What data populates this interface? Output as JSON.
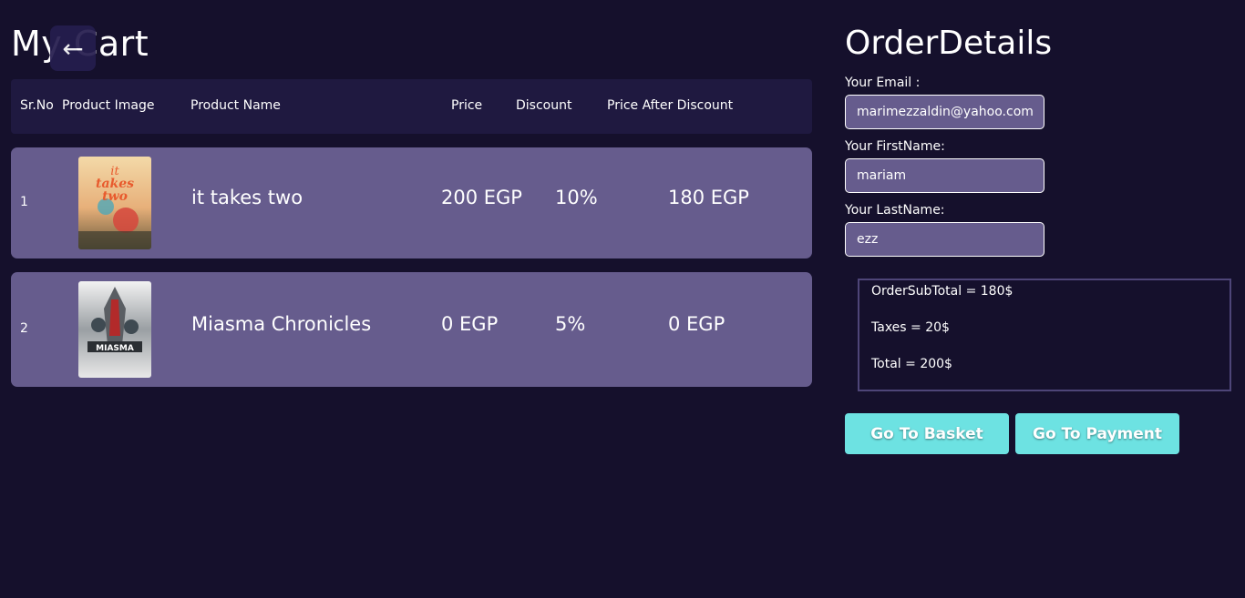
{
  "cart": {
    "title": "My Cart",
    "back_icon": "←",
    "headers": {
      "srno": "Sr.No",
      "image": "Product Image",
      "name": "Product Name",
      "price": "Price",
      "discount": "Discount",
      "after": "Price After Discount"
    },
    "rows": [
      {
        "srno": "1",
        "name": "it takes two",
        "price": "200 EGP",
        "discount": "10%",
        "after": "180 EGP",
        "image_icon": "it-takes-two-cover"
      },
      {
        "srno": "2",
        "name": "Miasma Chronicles",
        "price": "0 EGP",
        "discount": "5%",
        "after": "0 EGP",
        "image_icon": "miasma-chronicles-cover"
      }
    ]
  },
  "order": {
    "title": "OrderDetails",
    "email_label": "Your Email :",
    "email_value": "marimezzaldin@yahoo.com",
    "first_label": "Your FirstName:",
    "first_value": "mariam",
    "last_label": "Your LastName:",
    "last_value": "ezz",
    "subtotal": "OrderSubTotal = 180$",
    "taxes": "Taxes = 20$",
    "total": "Total = 200$",
    "basket_label": "Go To Basket",
    "payment_label": "Go To Payment"
  },
  "colors": {
    "background": "#15102c",
    "row": "#665c8d",
    "header": "#1f1940",
    "button": "#6de2e2"
  }
}
